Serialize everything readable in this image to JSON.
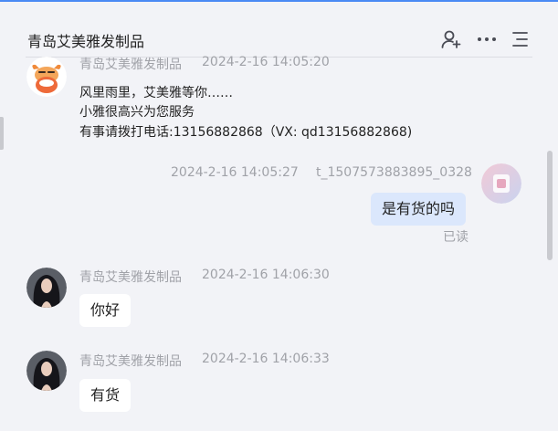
{
  "header": {
    "title": "青岛艾美雅发制品",
    "icons": [
      "add-user-icon",
      "more-icon",
      "menu-icon"
    ]
  },
  "messages": [
    {
      "sender": "青岛艾美雅发制品",
      "time": "2024-2-16 14:05:20",
      "lines": [
        "风里雨里，艾美雅等你……",
        "小雅很高兴为您服务",
        "有事请拨打电话:13156882868（VX: qd13156882868)"
      ],
      "avatar": "mascot-avatar"
    },
    {
      "sender": "t_1507573883895_0328",
      "time": "2024-2-16 14:05:27",
      "text": "是有货的吗",
      "status": "已读",
      "avatar": "user-avatar"
    },
    {
      "sender": "青岛艾美雅发制品",
      "time": "2024-2-16 14:06:30",
      "text": "你好",
      "avatar": "agent-photo-avatar"
    },
    {
      "sender": "青岛艾美雅发制品",
      "time": "2024-2-16 14:06:33",
      "text": "有货",
      "avatar": "agent-photo-avatar"
    }
  ],
  "colors": {
    "background": "#f2f3f7",
    "accent": "#4a8af4",
    "my_bubble": "#dbe7fc",
    "meta_text": "#a0a2a8"
  }
}
